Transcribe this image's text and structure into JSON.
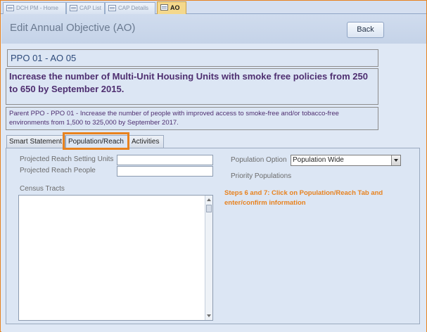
{
  "tabs": [
    {
      "label": "DCH PM - Home"
    },
    {
      "label": "CAP List"
    },
    {
      "label": "CAP Details"
    },
    {
      "label": "AO"
    }
  ],
  "header": {
    "title": "Edit Annual Objective (AO)",
    "back_label": "Back"
  },
  "objective": {
    "code": "PPO 01 - AO 05",
    "description": "Increase the number of Multi-Unit Housing Units with smoke free policies from 250 to 650 by September 2015.",
    "parent": "Parent PPO - PPO 01 - Increase the number of people with improved access to smoke-free and/or tobacco-free environments from 1,500 to 325,000 by September 2017."
  },
  "form_tabs": [
    {
      "label": "Smart Statement"
    },
    {
      "label": "Population/Reach"
    },
    {
      "label": "Activities"
    }
  ],
  "population": {
    "setting_units_label": "Projected Reach Setting Units",
    "setting_units_value": "",
    "people_label": "Projected Reach People",
    "people_value": "",
    "option_label": "Population Option",
    "option_value": "Population Wide",
    "priority_label": "Priority Populations",
    "census_label": "Census Tracts"
  },
  "annotation": {
    "text": "Steps 6 and 7: Click on Population/Reach Tab and enter/confirm information"
  },
  "colors": {
    "highlight": "#e8821e",
    "title_text": "#6a7a90",
    "objective_text": "#4e2e70"
  }
}
